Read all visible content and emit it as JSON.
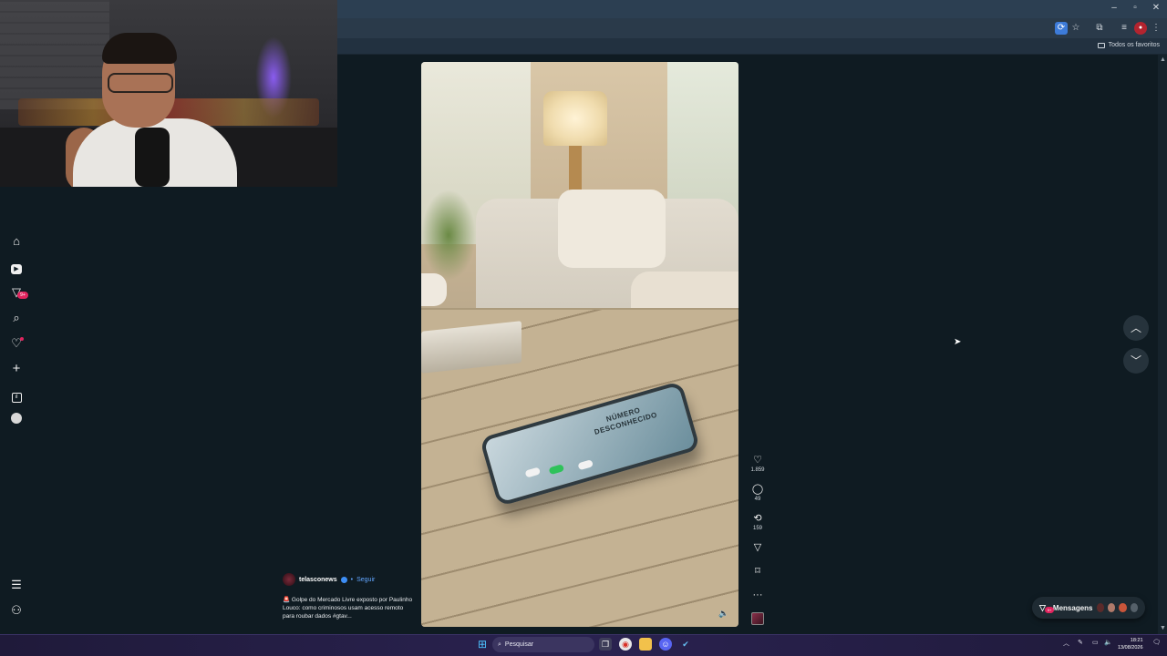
{
  "browser": {
    "bookmarks_folder": "Todos os favoritos",
    "window_controls": [
      "minimize-icon",
      "maximize-icon",
      "close-icon"
    ]
  },
  "left_nav": {
    "items": [
      "home-icon",
      "reels-icon",
      "messages-icon",
      "search-icon",
      "notifications-icon",
      "create-icon",
      "dashboard-icon",
      "profile-icon"
    ],
    "messages_badge": "9+",
    "bottom": [
      "menu-icon",
      "threads-icon"
    ]
  },
  "post": {
    "author": "telasconews",
    "follow_label": "Seguir",
    "separator": "•",
    "caption": "🚨 Golpe do Mercado Livre exposto por Paulinho Louco: como criminosos usam acesso remoto para roubar dados #gtav...",
    "phone_text": "NÚMERO DESCONHECIDO",
    "likes": "1.859",
    "comments": "49",
    "reposts": "159"
  },
  "messages_pill": {
    "label": "Mensagens",
    "badge": "9+"
  },
  "taskbar": {
    "search_placeholder": "Pesquisar",
    "time": "18:21",
    "date": "13/08/2026"
  }
}
